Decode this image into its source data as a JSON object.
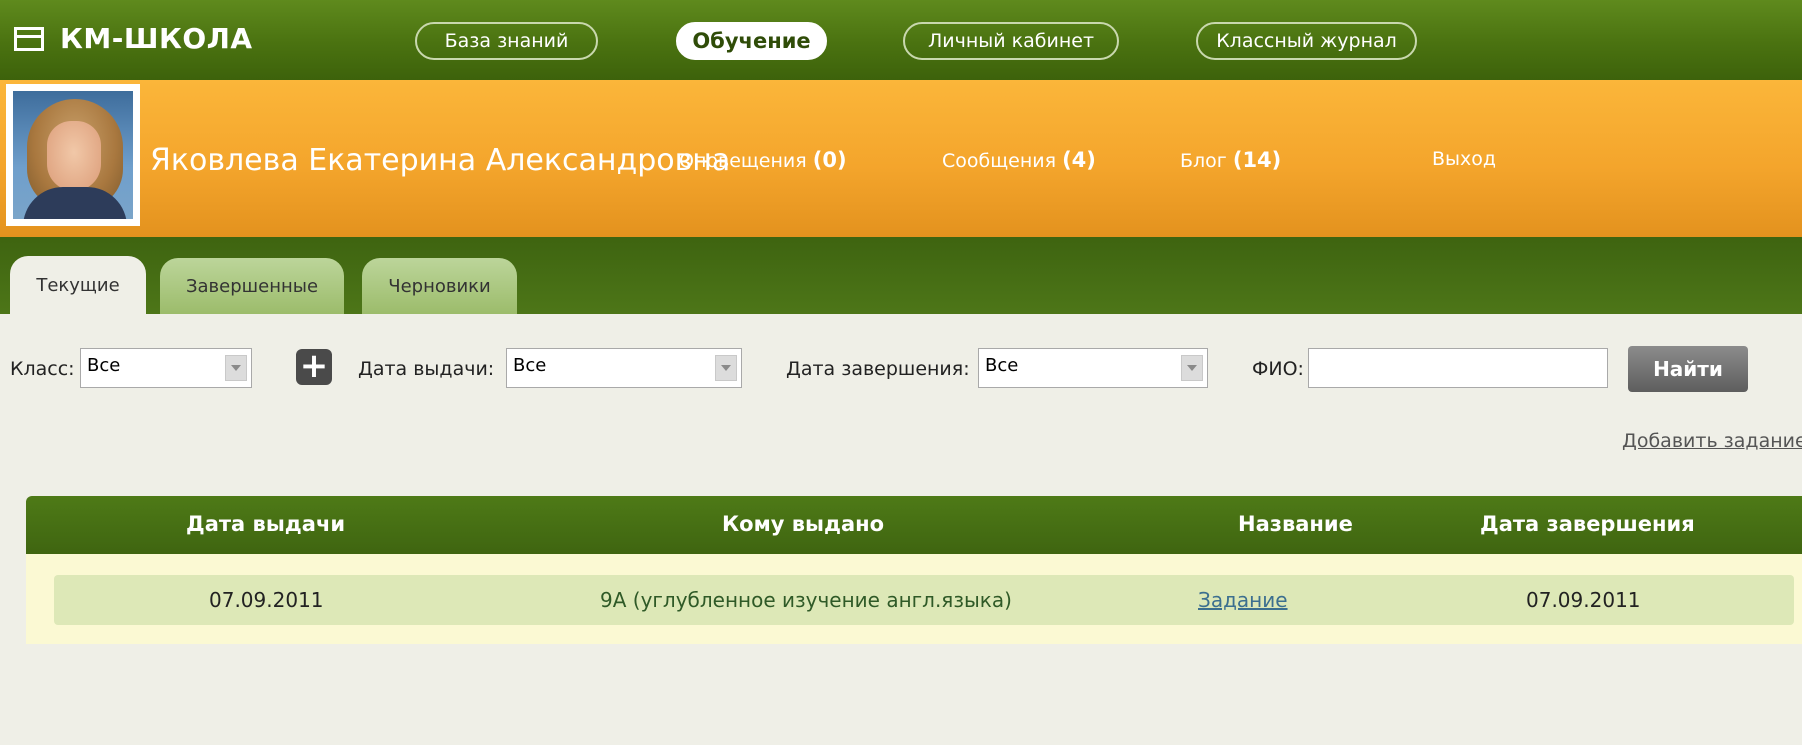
{
  "header": {
    "logo_text": "КМ-ШКОЛА",
    "nav": [
      {
        "label": "База знаний",
        "active": false
      },
      {
        "label": "Обучение",
        "active": true
      },
      {
        "label": "Личный кабинет",
        "active": false
      },
      {
        "label": "Классный журнал",
        "active": false
      }
    ]
  },
  "user": {
    "name": "Яковлева Екатерина Александровна",
    "notifications_label": "Оповещения",
    "notifications_count": "(0)",
    "messages_label": "Сообщения",
    "messages_count": "(4)",
    "blog_label": "Блог",
    "blog_count": "(14)",
    "logout_label": "Выход"
  },
  "tabs": [
    {
      "label": "Текущие",
      "active": true
    },
    {
      "label": "Завершенные",
      "active": false
    },
    {
      "label": "Черновики",
      "active": false
    }
  ],
  "filters": {
    "class_label": "Класс:",
    "class_value": "Все",
    "issue_date_label": "Дата выдачи:",
    "issue_date_value": "Все",
    "end_date_label": "Дата завершения:",
    "end_date_value": "Все",
    "fio_label": "ФИО:",
    "fio_value": "",
    "search_button": "Найти",
    "add_task_link": "Добавить задание"
  },
  "table": {
    "columns": [
      "Дата выдачи",
      "Кому выдано",
      "Название",
      "Дата завершения"
    ],
    "rows": [
      {
        "issue_date": "07.09.2011",
        "assigned_to": "9А (углубленное изучение англ.языка)",
        "title": "Задание",
        "end_date": "07.09.2011"
      }
    ]
  }
}
